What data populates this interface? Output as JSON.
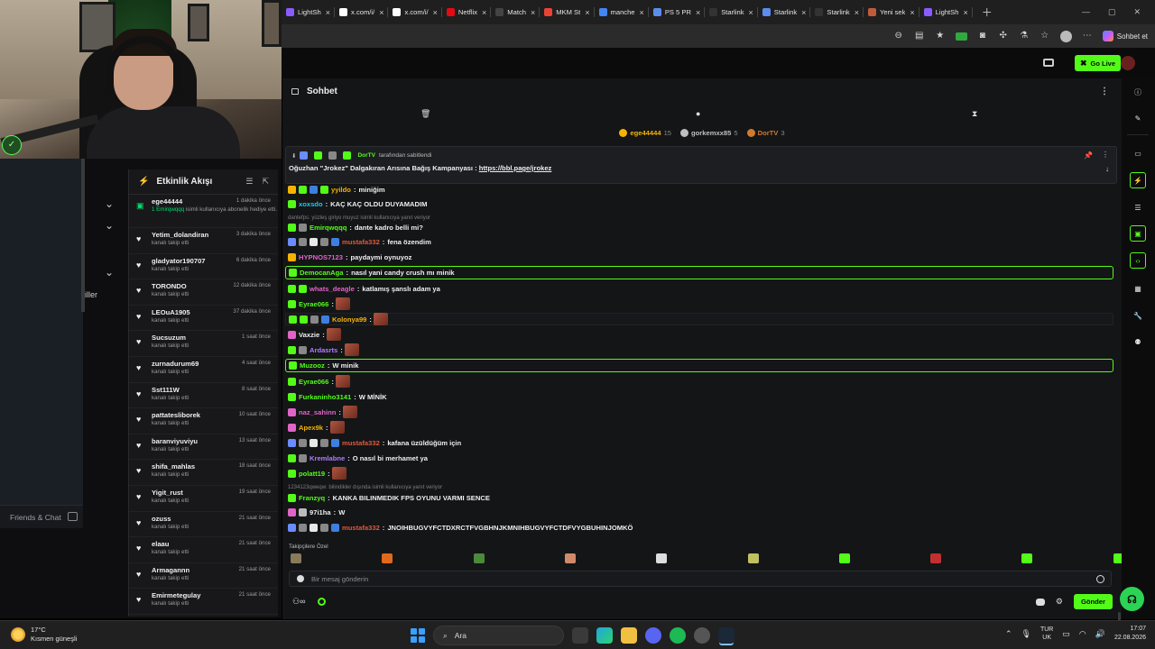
{
  "browser": {
    "tabs": [
      {
        "label": "LightSh",
        "color": "#8a5cff"
      },
      {
        "label": "x.com/i/",
        "color": "#ffffff"
      },
      {
        "label": "x.com/i/",
        "color": "#ffffff"
      },
      {
        "label": "Netflix",
        "color": "#e50914"
      },
      {
        "label": "Match",
        "color": "#444444"
      },
      {
        "label": "MKM St",
        "color": "#ea4335"
      },
      {
        "label": "manche",
        "color": "#4285f4"
      },
      {
        "label": "PS 5 PR",
        "color": "#5b8def"
      },
      {
        "label": "Starlink",
        "color": "#333333"
      },
      {
        "label": "Starlink",
        "color": "#5b8def"
      },
      {
        "label": "Starlink",
        "color": "#333333"
      },
      {
        "label": "Yeni sek",
        "color": "#c05b3c"
      },
      {
        "label": "LightSh",
        "color": "#8a5cff"
      }
    ],
    "sohbet_button": "Sohbet et"
  },
  "site": {
    "go_live_label": "Go Live"
  },
  "left": {
    "iller_label": "iller",
    "friends_chat": "Friends & Chat"
  },
  "feed": {
    "title": "Etkinlik Akışı",
    "items": [
      {
        "name": "ege44444",
        "time": "1 dakika önce",
        "desc_hl": "1 Emirqwqqq",
        "desc": " isimli kullanıcıya abonelik hediye etti."
      },
      {
        "name": "Yetim_dolandiran",
        "time": "3 dakika önce",
        "desc": "kanalı takip etti"
      },
      {
        "name": "gladyator190707",
        "time": "6 dakika önce",
        "desc": "kanalı takip etti"
      },
      {
        "name": "TORONDO",
        "time": "12 dakika önce",
        "desc": "kanalı takip etti"
      },
      {
        "name": "LEOuA1905",
        "time": "37 dakika önce",
        "desc": "kanalı takip etti"
      },
      {
        "name": "Sucsuzum",
        "time": "1 saat önce",
        "desc": "kanalı takip etti"
      },
      {
        "name": "zurnadurum69",
        "time": "4 saat önce",
        "desc": "kanalı takip etti"
      },
      {
        "name": "Sst111W",
        "time": "8 saat önce",
        "desc": "kanalı takip etti"
      },
      {
        "name": "pattatesliborek",
        "time": "10 saat önce",
        "desc": "kanalı takip etti"
      },
      {
        "name": "baranviyuviyu",
        "time": "13 saat önce",
        "desc": "kanalı takip etti"
      },
      {
        "name": "shifa_mahlas",
        "time": "18 saat önce",
        "desc": "kanalı takip etti"
      },
      {
        "name": "Yigit_rust",
        "time": "19 saat önce",
        "desc": "kanalı takip etti"
      },
      {
        "name": "ozuss",
        "time": "21 saat önce",
        "desc": "kanalı takip etti"
      },
      {
        "name": "elaau",
        "time": "21 saat önce",
        "desc": "kanalı takip etti"
      },
      {
        "name": "Armagannn",
        "time": "21 saat önce",
        "desc": "kanalı takip etti"
      },
      {
        "name": "Emirmetegulay",
        "time": "21 saat önce",
        "desc": "kanalı takip etti"
      }
    ]
  },
  "chat": {
    "title": "Sohbet",
    "leaders": [
      {
        "name": "ege44444",
        "count": "15",
        "color": "#f5b301"
      },
      {
        "name": "gorkemxx85",
        "count": "5",
        "color": "#bfbfbf"
      },
      {
        "name": "DorTV",
        "count": "3",
        "color": "#d07a2f"
      }
    ],
    "pinned": {
      "by": "DorTV",
      "by_suffix": "tarafından sabitlendi",
      "text": "Oğuzhan \"Jrokez\" Dalgakıran Arısına Bağış Kampanyası : ",
      "link": "https://bbl.page/jrokez"
    },
    "messages": [
      {
        "user": "yyildo",
        "color": "#f5b301",
        "text": "miniğim",
        "badges": [
          "#f5b301",
          "#53fc18",
          "#3d7fe0",
          "#53fc18"
        ]
      },
      {
        "user": "xoxsdo",
        "color": "#22c8e8",
        "text": "KAÇ KAÇ OLDU DUYAMADIM",
        "badges": [
          "#53fc18"
        ]
      },
      {
        "user": "Emirqwqqq",
        "color": "#53fc18",
        "text": "dante kadro belli mi?",
        "badges": [
          "#53fc18",
          "#888888"
        ]
      },
      {
        "user": "mustafa332",
        "color": "#e0593b",
        "text": "fena özendim",
        "badges": [
          "#6a8cff",
          "#888888",
          "#e8e8e8",
          "#888888",
          "#3d7fe0"
        ]
      },
      {
        "user": "HYPNOS7123",
        "color": "#e064c8",
        "text": "paydaymi oynuyoz",
        "badges": [
          "#f5b301"
        ]
      },
      {
        "user": "DemocanAga",
        "color": "#53fc18",
        "text": "nasıl yani candy crush mı minik",
        "badges": [
          "#53fc18"
        ]
      },
      {
        "user": "whats_deagle",
        "color": "#e064c8",
        "text": "katlamış şanslı adam ya",
        "badges": [
          "#53fc18",
          "#53fc18"
        ]
      },
      {
        "user": "Eyrae066",
        "color": "#53fc18",
        "text": "",
        "badges": [
          "#53fc18"
        ]
      },
      {
        "user": "Kolonya99",
        "color": "#f5b301",
        "text": "",
        "badges": [
          "#53fc18",
          "#53fc18",
          "#888888",
          "#3d7fe0"
        ]
      },
      {
        "user": "Vaxzie",
        "color": "#efeff1",
        "text": "",
        "badges": [
          "#e064c8"
        ]
      },
      {
        "user": "Ardasrts",
        "color": "#b07cff",
        "text": "",
        "badges": [
          "#53fc18",
          "#888888"
        ]
      },
      {
        "user": "Muzooz",
        "color": "#53fc18",
        "text": "W minik",
        "badges": [
          "#53fc18"
        ]
      },
      {
        "user": "Eyrae066",
        "color": "#53fc18",
        "text": "",
        "badges": [
          "#53fc18"
        ]
      },
      {
        "user": "Furkaninho3141",
        "color": "#53fc18",
        "text": "W MİNİK",
        "badges": [
          "#53fc18"
        ]
      },
      {
        "user": "naz_sahinn",
        "color": "#e064c8",
        "text": "",
        "badges": [
          "#e064c8"
        ]
      },
      {
        "user": "Apex9k",
        "color": "#f5b301",
        "text": "",
        "badges": [
          "#e064c8"
        ]
      },
      {
        "user": "mustafa332",
        "color": "#e0593b",
        "text": "kafana üzüldüğüm için",
        "badges": [
          "#6a8cff",
          "#888888",
          "#e8e8e8",
          "#888888",
          "#3d7fe0"
        ]
      },
      {
        "user": "Kremlabne",
        "color": "#b07cff",
        "text": "O nasıl bi merhamet ya",
        "badges": [
          "#53fc18",
          "#888888"
        ]
      },
      {
        "user": "polatt19",
        "color": "#53fc18",
        "text": "",
        "badges": [
          "#53fc18"
        ]
      },
      {
        "user": "Franzyq",
        "color": "#53fc18",
        "text": "KANKA BILINMEDIK FPS OYUNU VARMI SENCE",
        "badges": [
          "#53fc18"
        ]
      },
      {
        "user": "97i1ha",
        "color": "#efeff1",
        "text": "W",
        "badges": [
          "#e064c8",
          "#bbbbbb"
        ]
      },
      {
        "user": "mustafa332",
        "color": "#e0593b",
        "text": "JNOIHBUGVYFCTDXRCTFVGBHNJKMNIHBUGVYFCTDFVYGBUHINJOMKÖ",
        "badges": [
          "#6a8cff",
          "#888888",
          "#e8e8e8",
          "#888888",
          "#3d7fe0"
        ]
      }
    ],
    "replies": [
      {
        "text": "dantefps: yüzleş giriyo muyuz isimli kullanıcıya yanıt veriyor"
      },
      {
        "text": "1234123qweqw: bilindikler dışında isimli kullanıcıya yanıt veriyor"
      }
    ],
    "emote_label": "Takipçilere Özel",
    "input_placeholder": "Bir mesaj gönderin",
    "send_label": "Gönder"
  },
  "taskbar": {
    "temp": "17°C",
    "weather": "Kısmen güneşli",
    "search": "Ara",
    "lang1": "TUR",
    "lang2": "UK",
    "time": "17:07",
    "date": "22.08.2026"
  }
}
